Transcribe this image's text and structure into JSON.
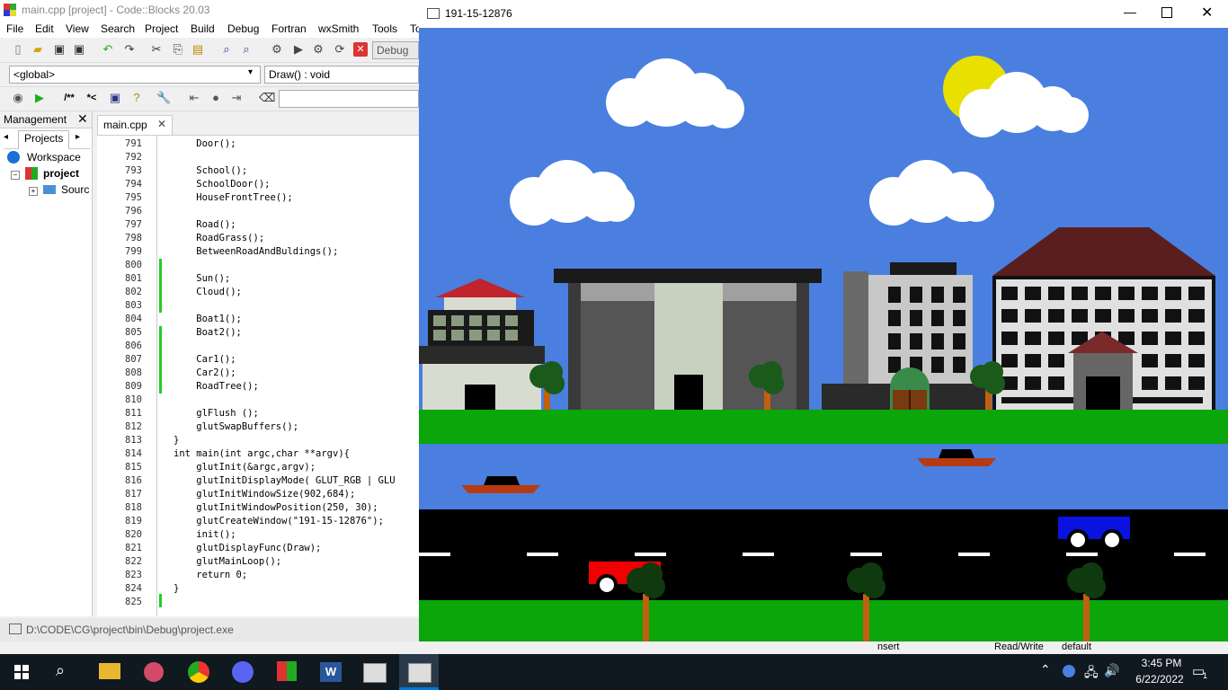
{
  "cb_window": {
    "title": "main.cpp [project] - Code::Blocks 20.03",
    "menus": [
      "File",
      "Edit",
      "View",
      "Search",
      "Project",
      "Build",
      "Debug",
      "Fortran",
      "wxSmith",
      "Tools",
      "To"
    ],
    "build_target": "Debug",
    "scope_combo": "<global>",
    "function_combo": "Draw() : void"
  },
  "management": {
    "title": "Management",
    "tab": "Projects",
    "tree": {
      "workspace": "Workspace",
      "project": "project",
      "sources": "Sourc"
    }
  },
  "editor": {
    "tab": "main.cpp",
    "lines": [
      {
        "n": "791",
        "code": "    Door();"
      },
      {
        "n": "792",
        "code": ""
      },
      {
        "n": "793",
        "code": "    School();"
      },
      {
        "n": "794",
        "code": "    SchoolDoor();"
      },
      {
        "n": "795",
        "code": "    HouseFrontTree();"
      },
      {
        "n": "796",
        "code": ""
      },
      {
        "n": "797",
        "code": "    Road();"
      },
      {
        "n": "798",
        "code": "    RoadGrass();"
      },
      {
        "n": "799",
        "code": "    BetweenRoadAndBuldings();"
      },
      {
        "n": "800",
        "code": ""
      },
      {
        "n": "801",
        "code": "    Sun();"
      },
      {
        "n": "802",
        "code": "    Cloud();"
      },
      {
        "n": "803",
        "code": ""
      },
      {
        "n": "804",
        "code": "    Boat1();"
      },
      {
        "n": "805",
        "code": "    Boat2();"
      },
      {
        "n": "806",
        "code": ""
      },
      {
        "n": "807",
        "code": "    Car1();"
      },
      {
        "n": "808",
        "code": "    Car2();"
      },
      {
        "n": "809",
        "code": "    RoadTree();"
      },
      {
        "n": "810",
        "code": ""
      },
      {
        "n": "811",
        "code": "    glFlush ();"
      },
      {
        "n": "812",
        "code": "    glutSwapBuffers();"
      },
      {
        "n": "813",
        "code": "}"
      },
      {
        "n": "814",
        "code": "int main(int argc,char **argv){"
      },
      {
        "n": "815",
        "code": "    glutInit(&argc,argv);"
      },
      {
        "n": "816",
        "code": "    glutInitDisplayMode( GLUT_RGB | GLU"
      },
      {
        "n": "817",
        "code": "    glutInitWindowSize(902,684);"
      },
      {
        "n": "818",
        "code": "    glutInitWindowPosition(250, 30);"
      },
      {
        "n": "819",
        "code": "    glutCreateWindow(\"191-15-12876\");"
      },
      {
        "n": "820",
        "code": "    init();"
      },
      {
        "n": "821",
        "code": "    glutDisplayFunc(Draw);"
      },
      {
        "n": "822",
        "code": "    glutMainLoop();"
      },
      {
        "n": "823",
        "code": "    return 0;"
      },
      {
        "n": "824",
        "code": "}"
      },
      {
        "n": "825",
        "code": ""
      }
    ]
  },
  "console": {
    "path": "D:\\CODE\\CG\\project\\bin\\Debug\\project.exe"
  },
  "gl_window": {
    "title": "191-15-12876"
  },
  "statusbar": {
    "insert": "nsert",
    "mode": "Read/Write",
    "profile": "default"
  },
  "taskbar": {
    "time": "3:45 PM",
    "date": "6/22/2022",
    "notification_count": "1"
  },
  "colors": {
    "sky": "#4a7fe0",
    "grass": "#0aa60a",
    "water": "#4a7fe0",
    "road": "#000000",
    "sun": "#e8e000",
    "accent_blue": "#0078d7"
  }
}
